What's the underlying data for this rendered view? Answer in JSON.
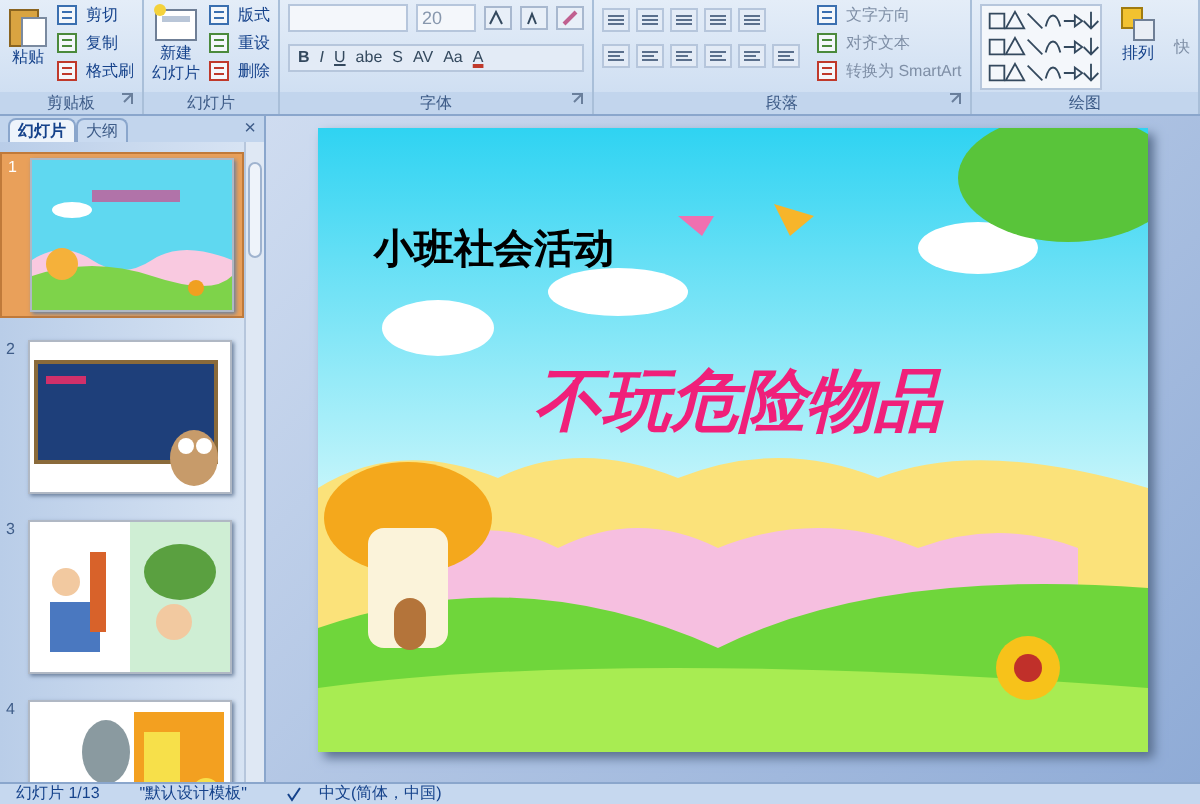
{
  "ribbon": {
    "groups": [
      {
        "kind": "clipboard",
        "label": "剪贴板",
        "launcher": true,
        "big": [
          "粘贴"
        ],
        "small": [
          "剪切",
          "复制",
          "格式刷"
        ]
      },
      {
        "kind": "slides",
        "label": "幻灯片",
        "launcher": false,
        "big": [
          "新建",
          "幻灯片"
        ],
        "small": [
          "版式",
          "重设",
          "删除"
        ]
      },
      {
        "kind": "font",
        "label": "字体",
        "launcher": true,
        "font_size": "20",
        "format_buttons": [
          "B",
          "I",
          "U",
          "abe",
          "S",
          "AV",
          "Aa",
          "A"
        ]
      },
      {
        "kind": "paragraph",
        "label": "段落",
        "launcher": true,
        "small": [
          "文字方向",
          "对齐文本",
          "转换为 SmartArt"
        ]
      },
      {
        "kind": "drawing",
        "label": "绘图",
        "launcher": false,
        "big": [
          "排列"
        ],
        "small": [
          "快"
        ]
      }
    ]
  },
  "panel": {
    "tabs": [
      {
        "label": "幻灯片",
        "selected": true
      },
      {
        "label": "大纲",
        "selected": false
      }
    ],
    "close": "×",
    "slides": [
      {
        "number": "1",
        "selected": true,
        "kind": "title"
      },
      {
        "number": "2",
        "selected": false,
        "kind": "board"
      },
      {
        "number": "3",
        "selected": false,
        "kind": "cartoon"
      },
      {
        "number": "4",
        "selected": false,
        "kind": "danger"
      }
    ]
  },
  "slide": {
    "subtitle": "小班社会活动",
    "title": "不玩危险物品"
  },
  "status_bar": {
    "slide": "幻灯片 1/13",
    "template": "\"默认设计模板\"",
    "language": "中文(简体，中国)"
  }
}
